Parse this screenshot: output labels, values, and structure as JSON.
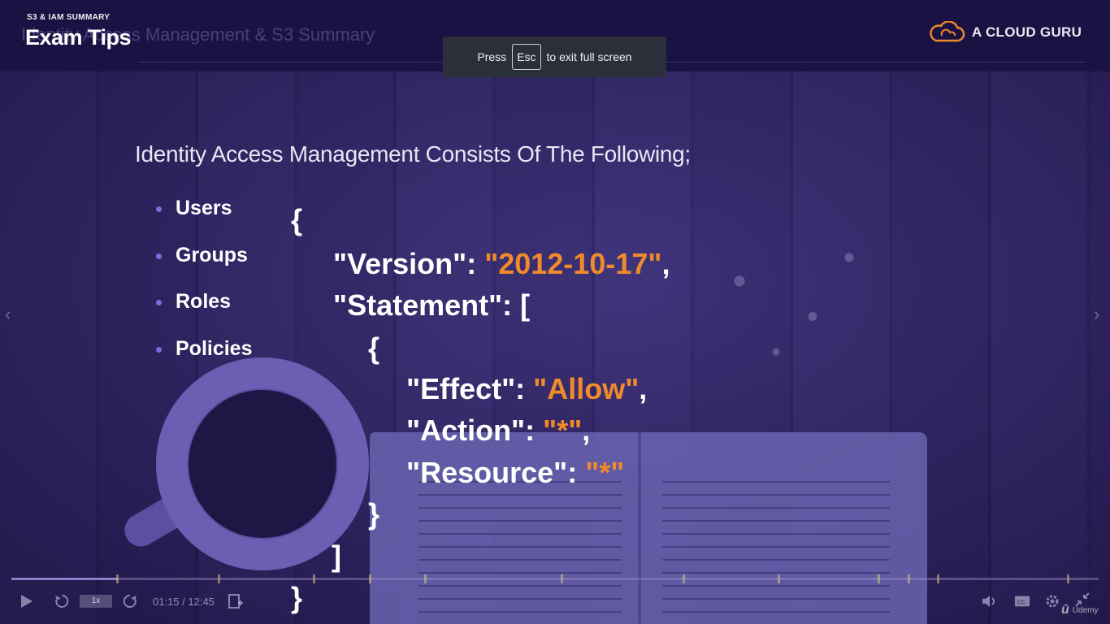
{
  "header": {
    "eyebrow": "S3 & IAM SUMMARY",
    "title": "Exam Tips",
    "ghost_title": "Identity Access Management & S3 Summary",
    "brand_name": "A CLOUD GURU"
  },
  "toast": {
    "press": "Press",
    "key": "Esc",
    "rest": "to exit full screen"
  },
  "slide": {
    "heading": "Identity Access Management Consists Of The Following;",
    "bullets": [
      "Users",
      "Groups",
      "Roles",
      "Policies"
    ],
    "code": {
      "open_brace": "{",
      "version_key": "\"Version\": ",
      "version_value": "\"2012-10-17\"",
      "comma": ",",
      "statement_key": "\"Statement\": [",
      "inner_open": "{",
      "effect_key": "\"Effect\": ",
      "effect_value": "\"Allow\"",
      "action_key": "\"Action\": ",
      "action_value": "\"*\"",
      "resource_key": "\"Resource\": ",
      "resource_value": "\"*\"",
      "inner_close": "}",
      "array_close": "]",
      "close_brace": "}"
    }
  },
  "player": {
    "speed": "1x",
    "time": "01:15 / 12:45",
    "progress_fraction": 0.098,
    "udemy_label": "Udemy"
  },
  "colors": {
    "accent_orange": "#f08a2a",
    "bullet_purple": "#7e6ae0",
    "header_bg": "#1b1244"
  }
}
